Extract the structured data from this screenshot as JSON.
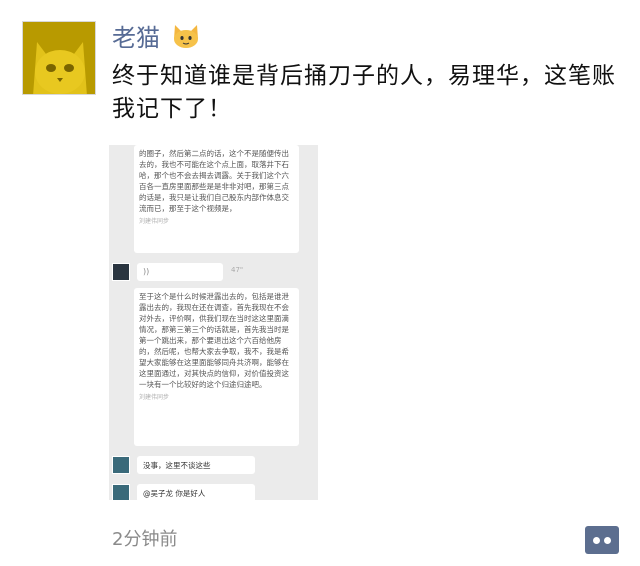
{
  "post": {
    "username": "老猫",
    "text": "终于知道谁是背后捅刀子的人，易理华，这笔账我记下了！",
    "time": "2分钟前"
  },
  "screenshot": {
    "msg1": "的圈子，然后第二点的话，这个不是随便传出去的，我也不可能在这个点上面，取落井下石哈，那个也不会去揭去调露。关于我们这个六百各一直房里面那些是是非非对吧，那第三点的话是，我只是让我们自己股东内部作体息交流而已，那至于这个视频是，",
    "msg1_foot": "刘建伟同步",
    "voice_symbol": "))",
    "voice_seconds": "47\"",
    "msg2": "至于这个是什么时候泄露出去的，包括是谁泄露出去的，我现在还在调查，首先我现在不会对外去，评价啊，供我们现在当时这这里面滴情况，那第三第三个的话就是，首先我当时是第一个跳出来，那个要退出这个六百给他房的，然后呢，也帮大家去争取，我不，我是希望大家能够在这里面能够同舟共济啊，能够在这里面通过，对其快点的信仰，对价值投资这一块有一个比较好的这个归途归途吧。",
    "msg2_foot": "刘建伟同步",
    "msg3": "没事，这里不谈这些",
    "msg4": "@吴子龙  你是好人"
  },
  "icons": {
    "emoji": "cat-face-icon",
    "comment": "comment-dots-icon"
  }
}
